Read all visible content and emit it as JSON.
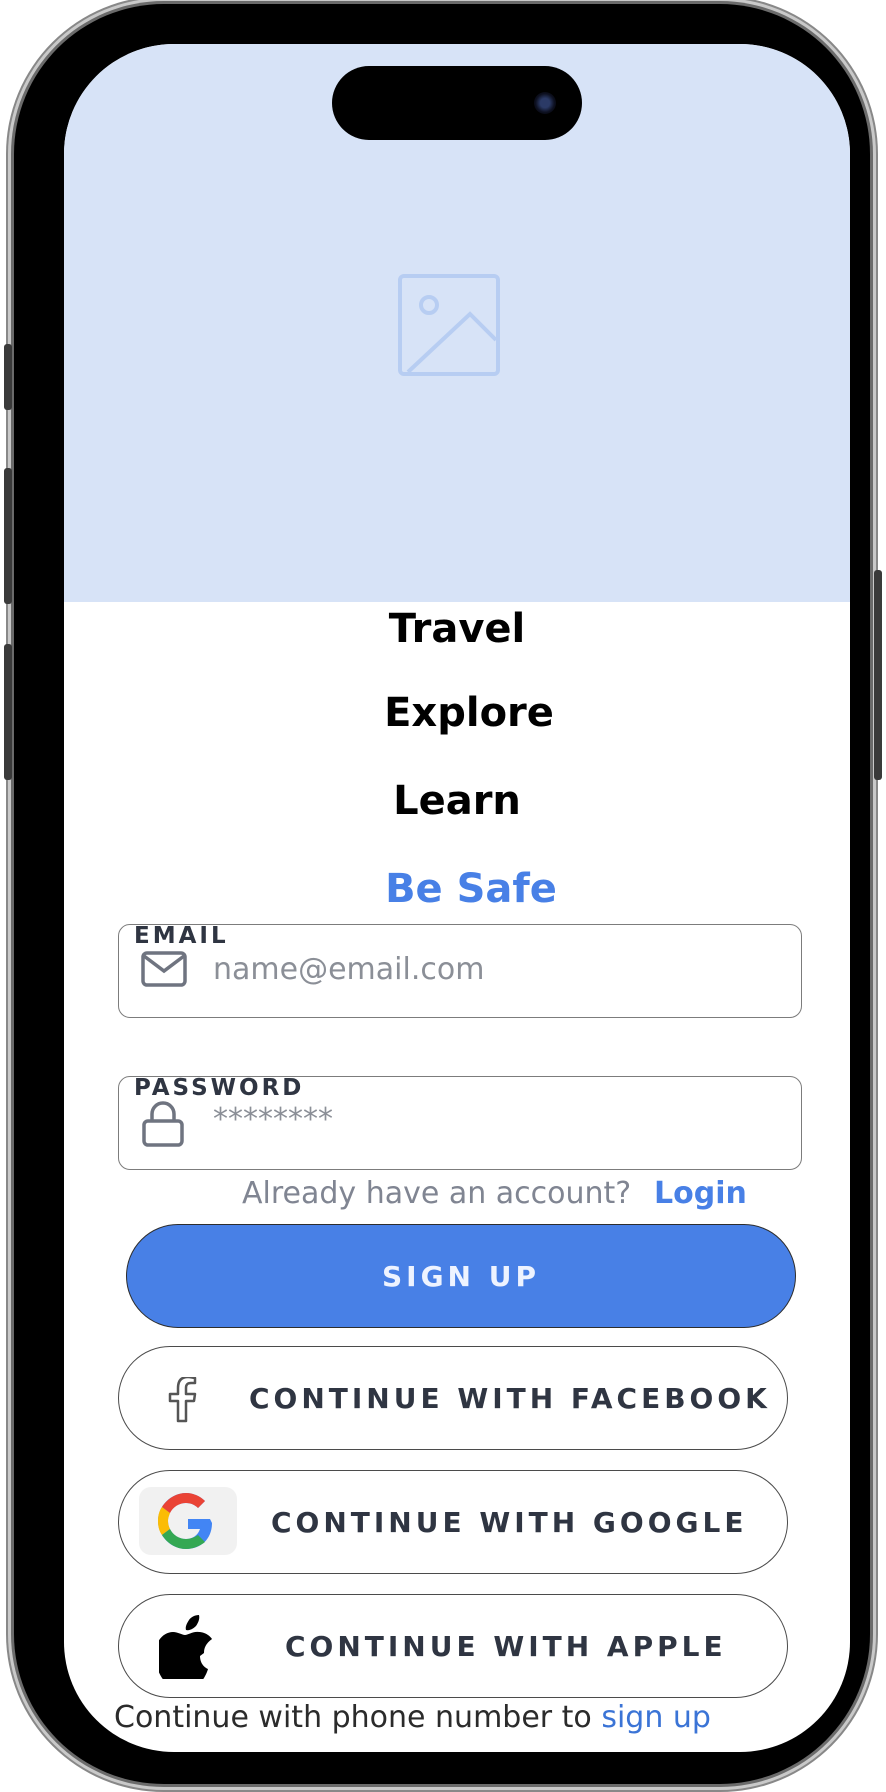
{
  "hero": {
    "image_icon": "image-placeholder-icon"
  },
  "taglines": [
    "Travel",
    "Explore",
    "Learn",
    "Be Safe"
  ],
  "email": {
    "label": "EMAIL",
    "placeholder": "name@email.com",
    "icon": "mail-icon"
  },
  "password": {
    "label": "PASSWORD",
    "placeholder": "********",
    "icon": "lock-icon"
  },
  "login_prompt": {
    "question": "Already have an account?",
    "link": "Login"
  },
  "signup_button": "SIGN UP",
  "social": {
    "facebook": "CONTINUE WITH FACEBOOK",
    "google": "CONTINUE WITH GOOGLE",
    "apple": "CONTINUE WITH APPLE"
  },
  "footer": {
    "text": "Continue with phone number to",
    "link": "sign up"
  },
  "colors": {
    "accent": "#4880e6",
    "hero_bg": "#d7e3f7",
    "text_dark": "#2f3542"
  }
}
